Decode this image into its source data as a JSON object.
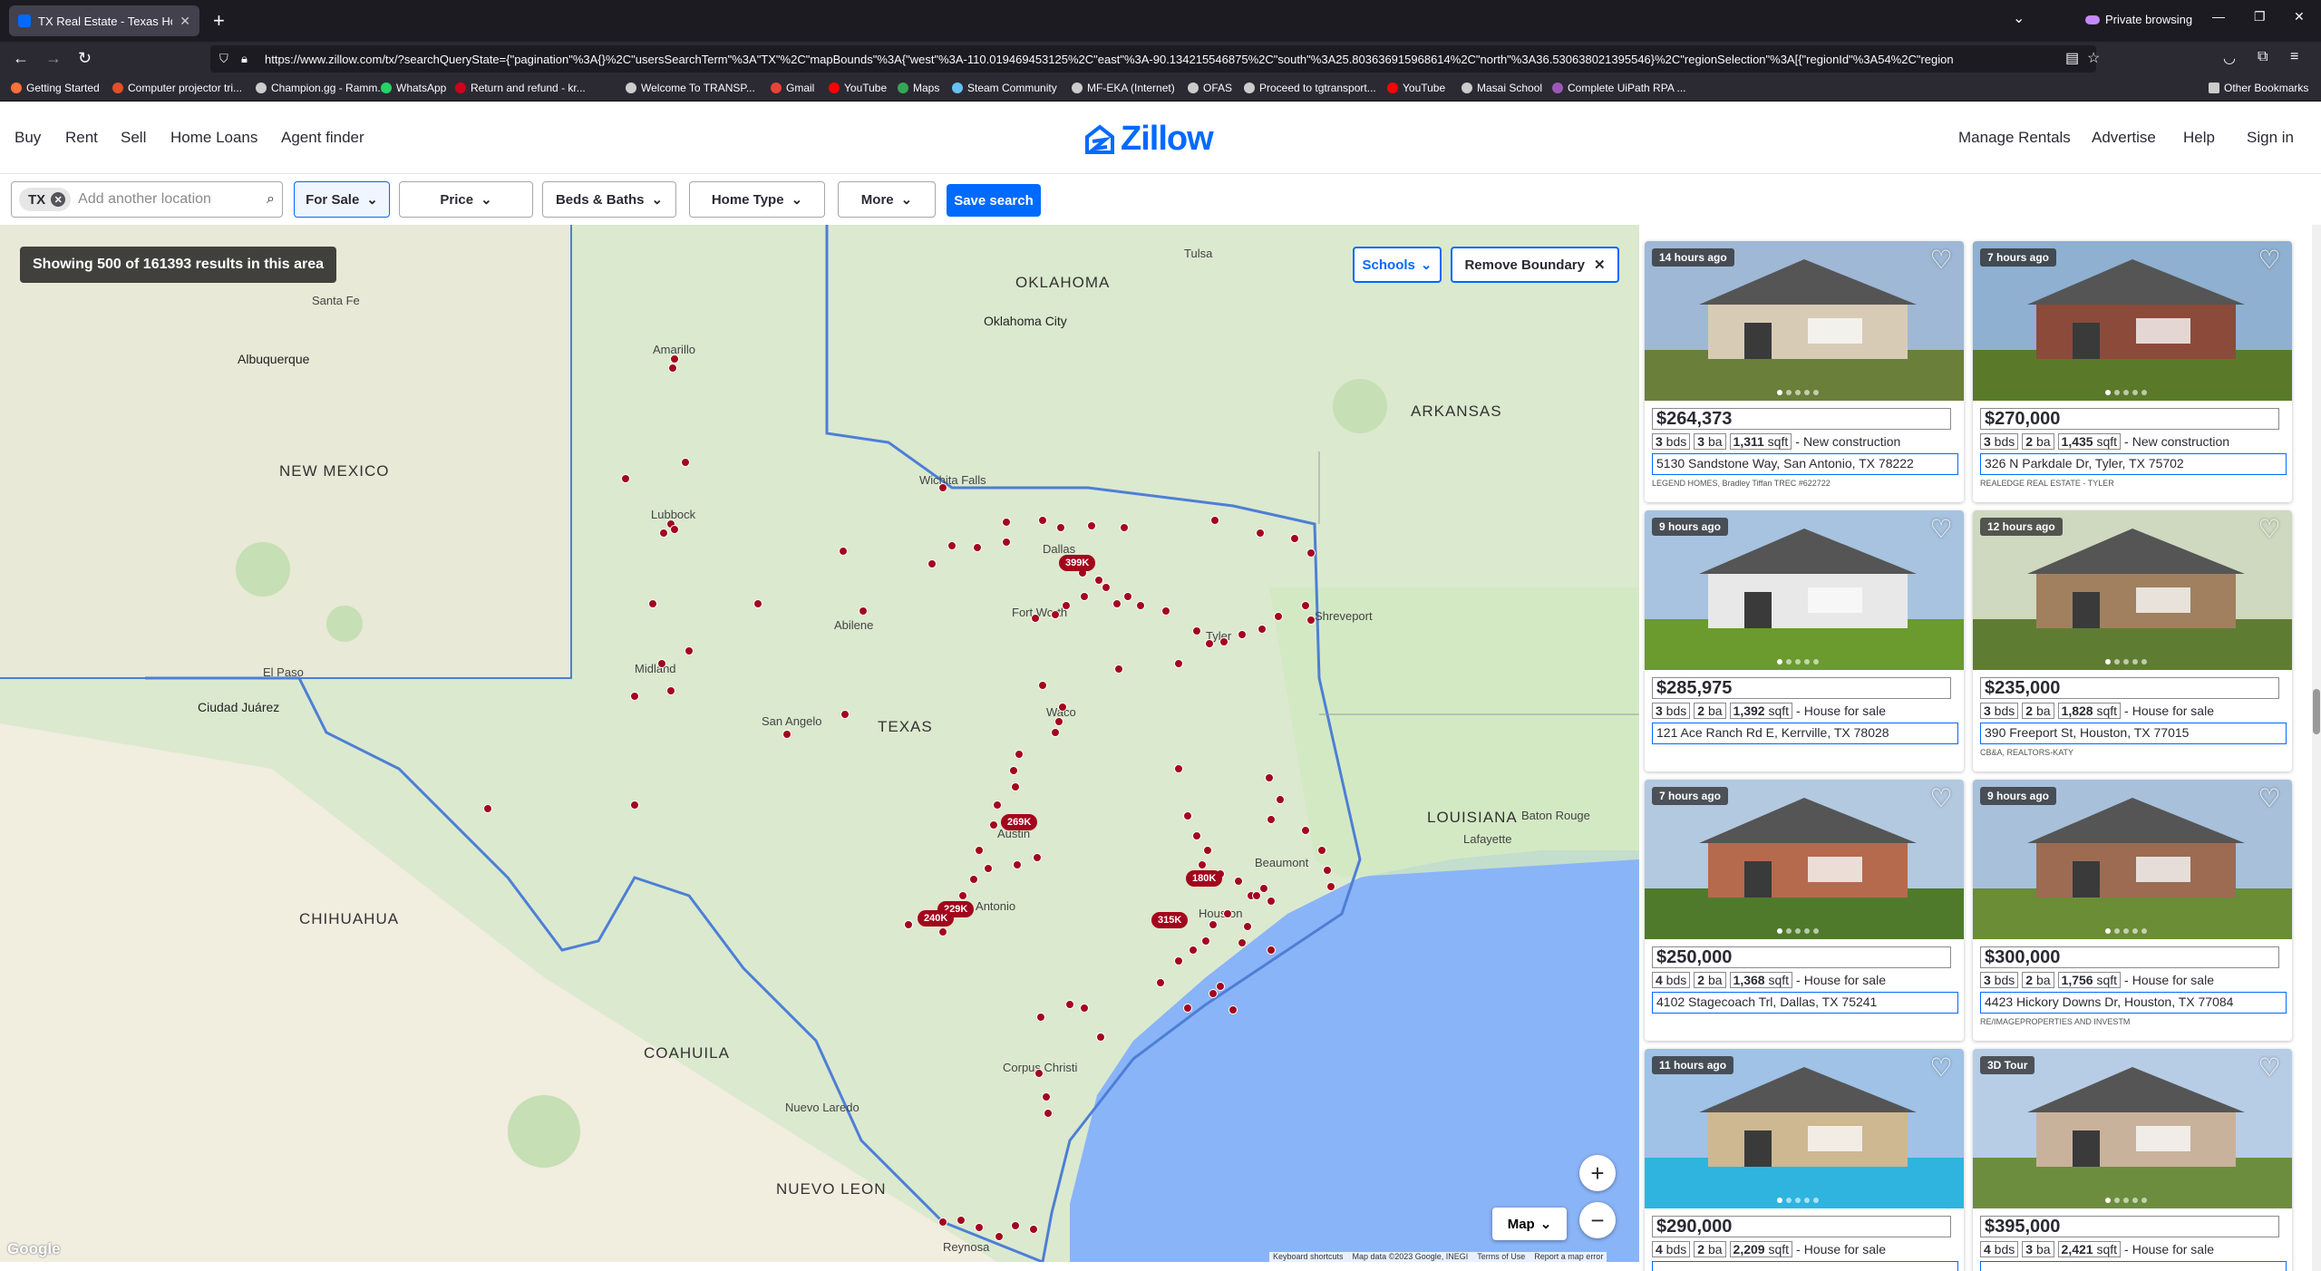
{
  "browser": {
    "tab_title": "TX Real Estate - Texas Homes F",
    "url": "https://www.zillow.com/tx/?searchQueryState={\"pagination\"%3A{}%2C\"usersSearchTerm\"%3A\"TX\"%2C\"mapBounds\"%3A{\"west\"%3A-110.019469453125%2C\"east\"%3A-90.134215546875%2C\"south\"%3A25.803636915968614%2C\"north\"%3A36.530638021395546}%2C\"regionSelection\"%3A[{\"regionId\"%3A54%2C\"region",
    "private_label": "Private browsing"
  },
  "bookmarks": [
    {
      "label": "Getting Started",
      "color": "#ff7139"
    },
    {
      "label": "Computer projector tri...",
      "color": "#e34f26"
    },
    {
      "label": "Champion.gg - Ramm...",
      "color": "#cccccc"
    },
    {
      "label": "WhatsApp",
      "color": "#25d366"
    },
    {
      "label": "Return and refund - kr...",
      "color": "#d0021b"
    },
    {
      "label": "Welcome To TRANSP...",
      "color": "#cccccc"
    },
    {
      "label": "Gmail",
      "color": "#ea4335"
    },
    {
      "label": "YouTube",
      "color": "#ff0000"
    },
    {
      "label": "Maps",
      "color": "#34a853"
    },
    {
      "label": "Steam Community",
      "color": "#66c0f4"
    },
    {
      "label": "MF-EKA (Internet)",
      "color": "#cccccc"
    },
    {
      "label": "OFAS",
      "color": "#cccccc"
    },
    {
      "label": "Proceed to tgtransport...",
      "color": "#cccccc"
    },
    {
      "label": "YouTube",
      "color": "#ff0000"
    },
    {
      "label": "Masai School",
      "color": "#cccccc"
    },
    {
      "label": "Complete UiPath RPA ...",
      "color": "#9b59b6"
    }
  ],
  "other_bookmarks": "Other Bookmarks",
  "zillow": {
    "nav_left": [
      "Buy",
      "Rent",
      "Sell",
      "Home Loans",
      "Agent finder"
    ],
    "logo": "Zillow",
    "nav_right": [
      "Manage Rentals",
      "Advertise",
      "Help",
      "Sign in"
    ]
  },
  "filters": {
    "location_chip": "TX",
    "location_placeholder": "Add another location",
    "for_sale": "For Sale",
    "price": "Price",
    "beds_baths": "Beds & Baths",
    "home_type": "Home Type",
    "more": "More",
    "save_search": "Save search"
  },
  "map": {
    "results_text": "Showing 500 of 161393 results in this area",
    "schools": "Schools",
    "remove_boundary": "Remove Boundary",
    "map_type": "Map",
    "google": "Google",
    "attribution": [
      "Keyboard shortcuts",
      "Map data ©2023 Google, INEGI",
      "Terms of Use",
      "Report a map error"
    ],
    "price_pins": [
      "399K",
      "269K",
      "180K",
      "229K",
      "240K",
      "315K"
    ],
    "labels": [
      "OKLAHOMA",
      "Oklahoma City",
      "NEW MEXICO",
      "Albuquerque",
      "ARKANSAS",
      "TEXAS",
      "LOUISIANA",
      "CHIHUAHUA",
      "COAHUILA",
      "NUEVO LEON",
      "Ciudad Juárez",
      "Amarillo",
      "Lubbock",
      "Dallas",
      "Fort Worth",
      "Austin",
      "San Antonio",
      "Houston",
      "Corpus Christi",
      "Shreveport",
      "Tyler",
      "Waco",
      "El Paso",
      "Santa Fe",
      "Abilene",
      "Midland",
      "San Angelo",
      "Beaumont",
      "Baton Rouge",
      "Lafayette",
      "Tulsa",
      "Wichita Falls",
      "Nuevo Laredo",
      "Reynosa"
    ]
  },
  "listings": [
    {
      "age": "14 hours ago",
      "price": "$264,373",
      "beds": "3",
      "baths": "3",
      "sqft": "1,311",
      "type": "New construction",
      "address": "5130 Sandstone Way, San Antonio, TX 78222",
      "broker": "LEGEND HOMES, Bradley Tiffan TREC #622722",
      "photo": "house-beige-garage"
    },
    {
      "age": "7 hours ago",
      "price": "$270,000",
      "beds": "3",
      "baths": "2",
      "sqft": "1,435",
      "type": "New construction",
      "address": "326 N Parkdale Dr, Tyler, TX 75702",
      "broker": "REALEDGE REAL ESTATE - TYLER",
      "photo": "house-brick-dark"
    },
    {
      "age": "9 hours ago",
      "price": "$285,975",
      "beds": "3",
      "baths": "2",
      "sqft": "1,392",
      "type": "House for sale",
      "address": "121 Ace Ranch Rd E, Kerrville, TX 78028",
      "broker": "",
      "photo": "house-white-lawn"
    },
    {
      "age": "12 hours ago",
      "price": "$235,000",
      "beds": "3",
      "baths": "2",
      "sqft": "1,828",
      "type": "House for sale",
      "address": "390 Freeport St, Houston, TX 77015",
      "broker": "CB&A, REALTORS-KATY",
      "photo": "house-trees"
    },
    {
      "age": "7 hours ago",
      "price": "$250,000",
      "beds": "4",
      "baths": "2",
      "sqft": "1,368",
      "type": "House for sale",
      "address": "4102 Stagecoach Trl, Dallas, TX 75241",
      "broker": "",
      "photo": "house-brick-tree"
    },
    {
      "age": "9 hours ago",
      "price": "$300,000",
      "beds": "3",
      "baths": "2",
      "sqft": "1,756",
      "type": "House for sale",
      "address": "4423 Hickory Downs Dr, Houston, TX 77084",
      "broker": "RE/IMAGEPROPERTIES AND INVESTM",
      "photo": "house-brick-lawn"
    },
    {
      "age": "11 hours ago",
      "price": "$290,000",
      "beds": "4",
      "baths": "2",
      "sqft": "2,209",
      "type": "House for sale",
      "address": "",
      "broker": "",
      "photo": "house-pool"
    },
    {
      "age": "3D Tour",
      "price": "$395,000",
      "beds": "4",
      "baths": "3",
      "sqft": "2,421",
      "type": "House for sale",
      "address": "",
      "broker": "",
      "photo": "house-two-story"
    }
  ]
}
